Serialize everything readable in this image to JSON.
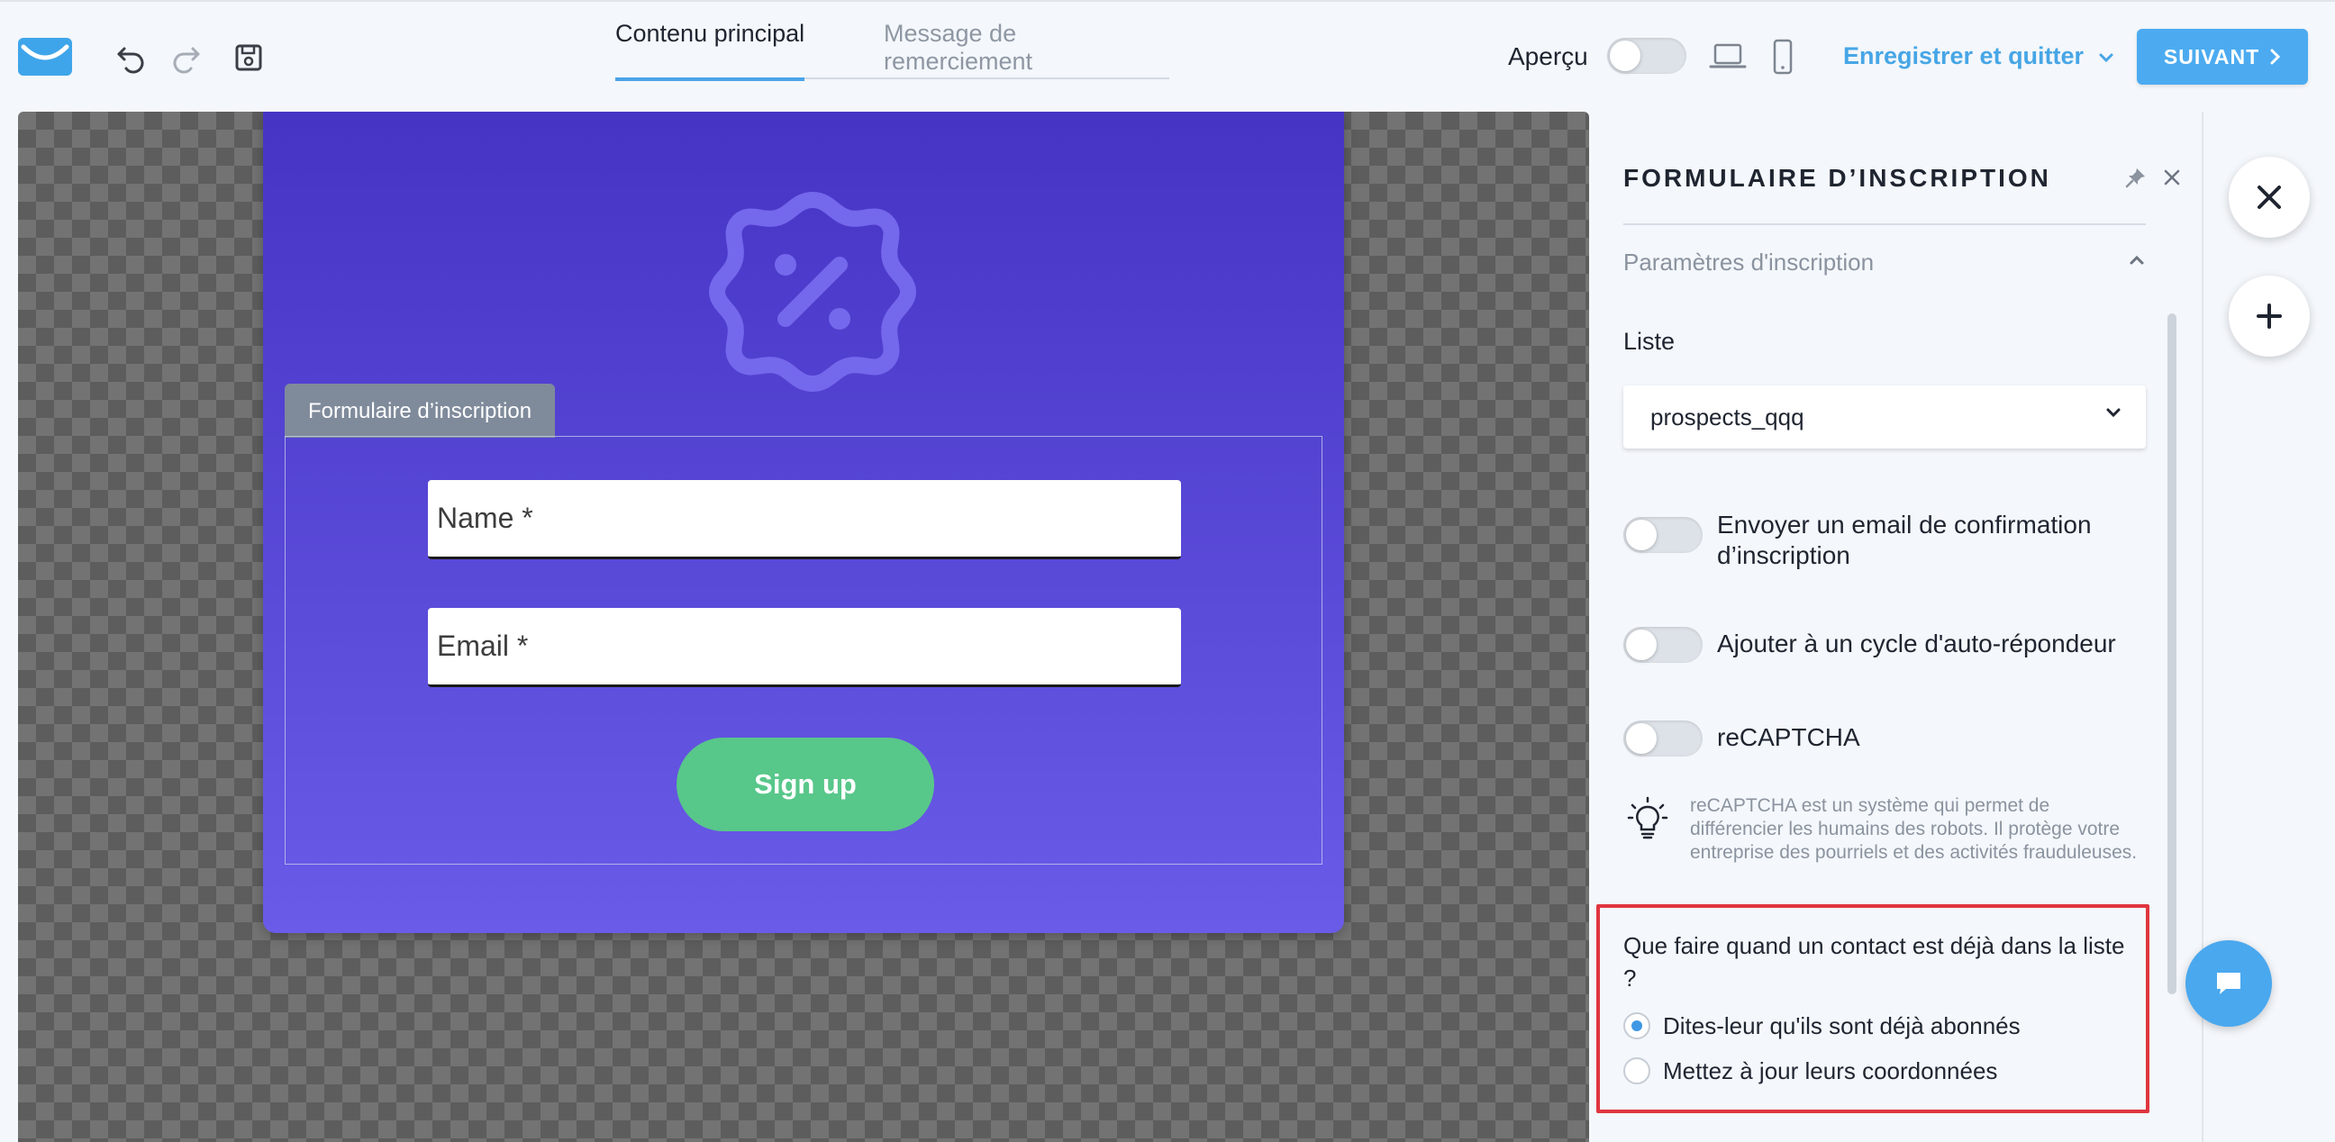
{
  "topbar": {
    "tabs": [
      {
        "label": "Contenu principal",
        "active": true
      },
      {
        "label": "Message de remerciement",
        "active": false
      }
    ],
    "preview_label": "Aperçu",
    "save_quit_label": "Enregistrer et quitter",
    "next_label": "SUIVANT",
    "icons": [
      "logo-icon",
      "undo-icon",
      "redo-icon",
      "save-icon",
      "laptop-icon",
      "mobile-icon"
    ]
  },
  "canvas": {
    "form_tag": "Formulaire d’inscription",
    "name_placeholder": "Name *",
    "email_placeholder": "Email *",
    "signup_label": "Sign up",
    "colors": {
      "card_top": "#4634c4",
      "card_bottom": "#6a5be8",
      "button": "#58c78a"
    }
  },
  "panel": {
    "title": "FORMULAIRE D’INSCRIPTION",
    "section": "Paramètres d'inscription",
    "list_label": "Liste",
    "list_value": "prospects_qqq",
    "options": [
      {
        "label": "Envoyer un email de confirmation d’inscription",
        "enabled": false
      },
      {
        "label": "Ajouter à un cycle d'auto-répondeur",
        "enabled": false
      },
      {
        "label": "reCAPTCHA",
        "enabled": false
      }
    ],
    "tip": "reCAPTCHA est un système qui permet de différencier les humains des robots. Il protège votre entreprise des pourriels et des activités frauduleuses.",
    "question": "Que faire quand un contact est déjà dans la liste ?",
    "radios": [
      {
        "label": "Dites-leur qu'ils sont déjà abonnés",
        "checked": true
      },
      {
        "label": "Mettez à jour leurs coordonnées",
        "checked": false
      }
    ],
    "highlight_color": "#e0353f"
  },
  "accent": "#4cabf0"
}
